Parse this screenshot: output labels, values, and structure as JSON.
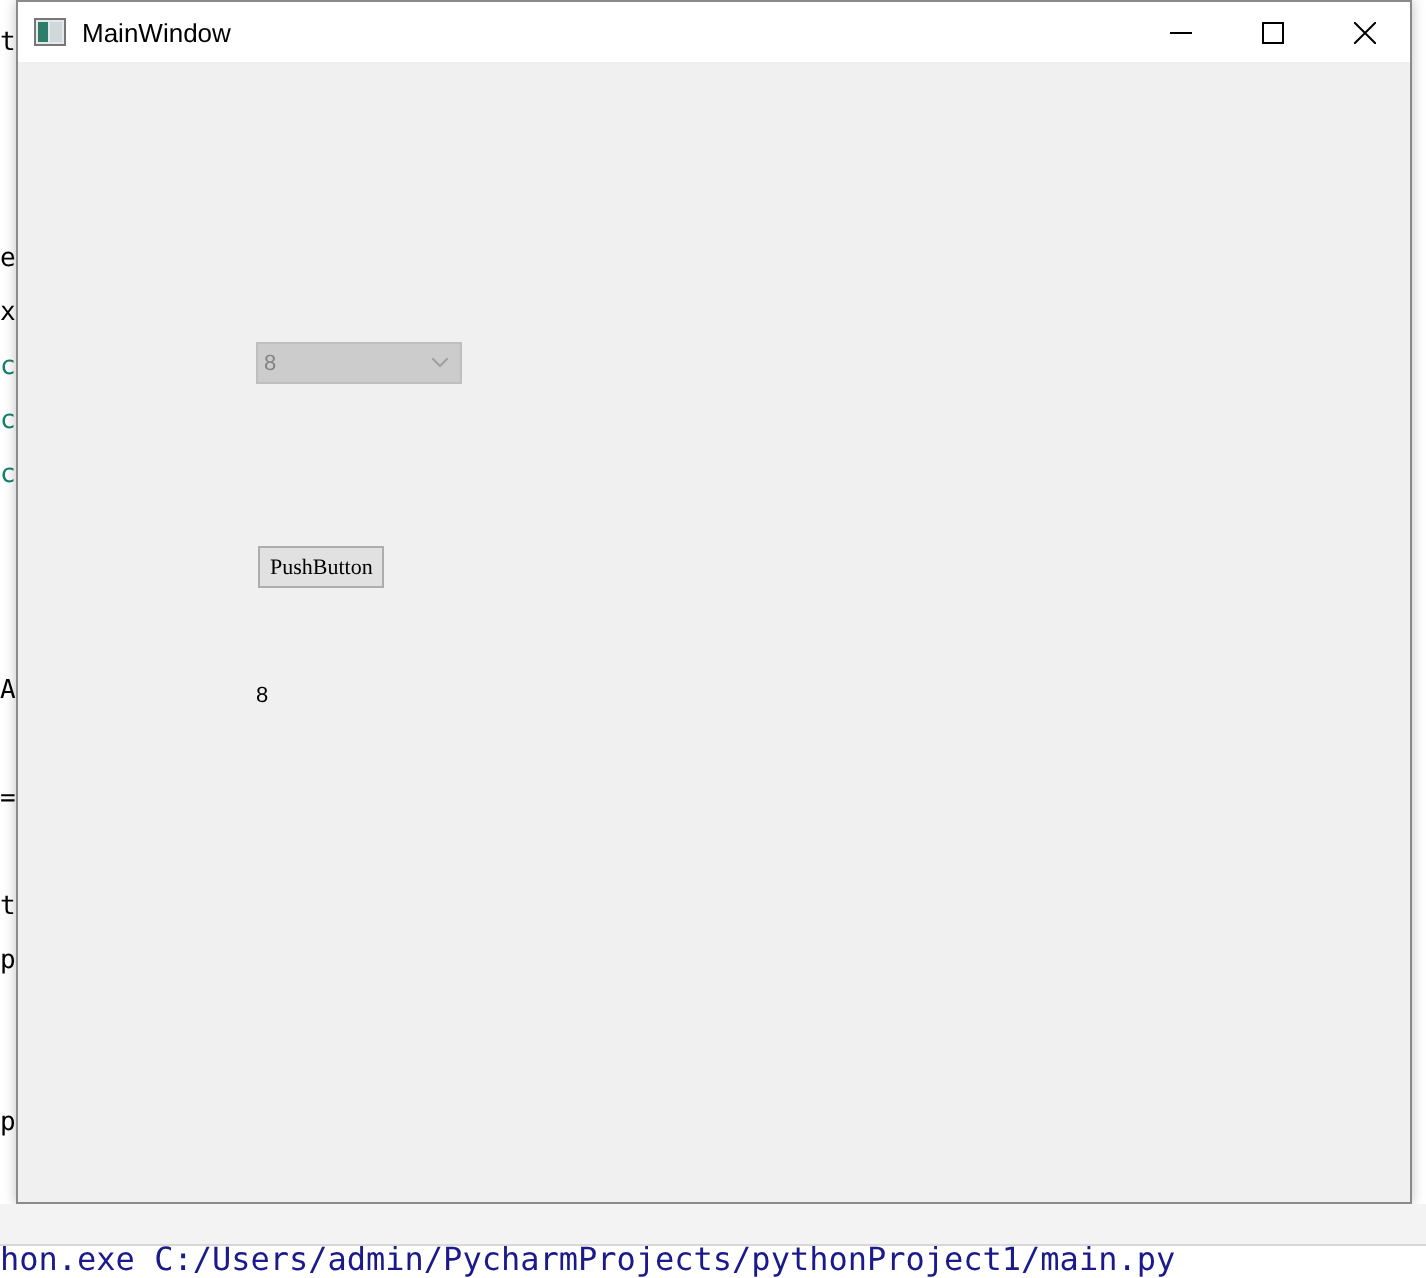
{
  "editor_lines": [
    {
      "kind": "code",
      "text": "t",
      "color": "#000000"
    },
    {
      "kind": "blank"
    },
    {
      "kind": "blank"
    },
    {
      "kind": "blank"
    },
    {
      "kind": "code",
      "text": "e",
      "color": "#000000"
    },
    {
      "kind": "code",
      "text": "x",
      "color": "#000000"
    },
    {
      "kind": "code",
      "text": "c",
      "color": "#14806e"
    },
    {
      "kind": "code",
      "text": "c",
      "color": "#14806e"
    },
    {
      "kind": "code",
      "text": "c",
      "color": "#14806e"
    },
    {
      "kind": "blank"
    },
    {
      "kind": "blank"
    },
    {
      "kind": "blank"
    },
    {
      "kind": "code",
      "text": "A",
      "color": "#000000"
    },
    {
      "kind": "blank"
    },
    {
      "kind": "code",
      "text": "=",
      "color": "#000000"
    },
    {
      "kind": "blank"
    },
    {
      "kind": "code",
      "text": "t",
      "color": "#000000"
    },
    {
      "kind": "code",
      "text": "p",
      "color": "#000000"
    },
    {
      "kind": "blank"
    },
    {
      "kind": "blank"
    },
    {
      "kind": "code",
      "text": "p",
      "color": "#000000"
    }
  ],
  "window": {
    "title": "MainWindow"
  },
  "combo_box": {
    "value": "8",
    "disabled": true
  },
  "push_button": {
    "label": "PushButton"
  },
  "label": {
    "text": "8"
  },
  "console": {
    "text": "hon.exe C:/Users/admin/PycharmProjects/pythonProject1/main.py"
  }
}
